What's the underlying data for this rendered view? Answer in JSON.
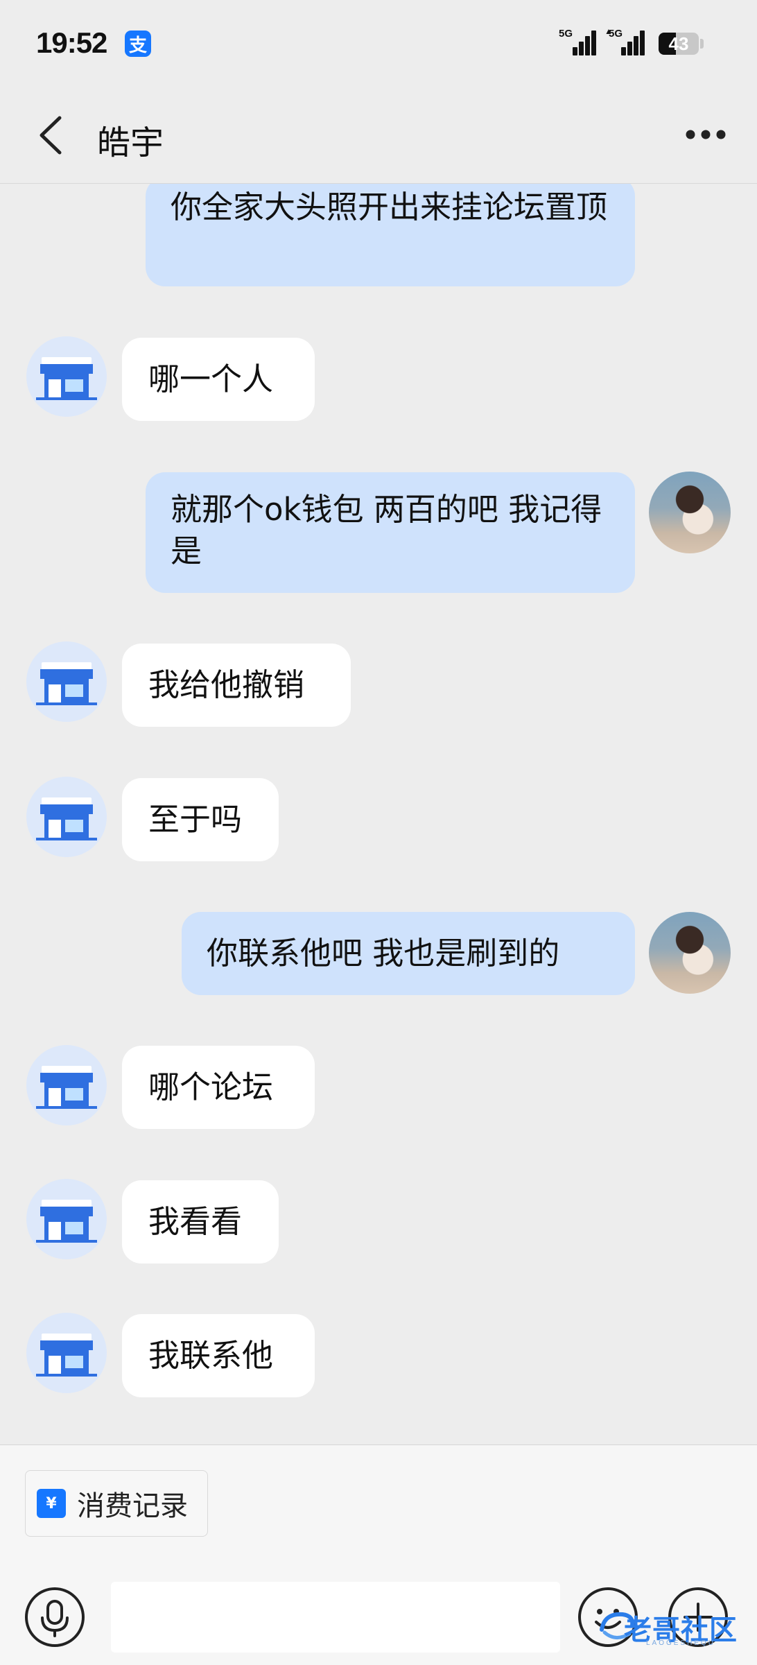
{
  "status_bar": {
    "time": "19:52",
    "app_badge": "支",
    "signal1_label": "5G",
    "signal2_label": "5G",
    "battery": "43",
    "battery_level": 0.43
  },
  "nav": {
    "title": "皓宇"
  },
  "messages": [
    {
      "side": "sent",
      "text": "你全家大头照开出来挂论坛置顶"
    },
    {
      "side": "received",
      "text": "哪一个人"
    },
    {
      "side": "sent",
      "text": "就那个ok钱包 两百的吧 我记得是"
    },
    {
      "side": "received",
      "text": "我给他撤销"
    },
    {
      "side": "received",
      "text": "至于吗"
    },
    {
      "side": "sent",
      "text": "你联系他吧 我也是刷到的"
    },
    {
      "side": "received",
      "text": "哪个论坛"
    },
    {
      "side": "received",
      "text": "我看看"
    },
    {
      "side": "received",
      "text": "我联系他"
    }
  ],
  "bottom": {
    "records_icon": "¥",
    "records_label": "消费记录",
    "input_value": ""
  },
  "watermark": {
    "text": "老哥社区",
    "sub": "LAOGESHEQU"
  },
  "colors": {
    "sent_bubble": "#cfe2fc",
    "received_bubble": "#ffffff",
    "background": "#ededed",
    "accent": "#1677ff"
  },
  "icons": [
    "back-arrow-icon",
    "more-dots-icon",
    "shop-avatar-icon",
    "voice-icon",
    "emoji-icon",
    "plus-icon",
    "receipt-icon"
  ]
}
